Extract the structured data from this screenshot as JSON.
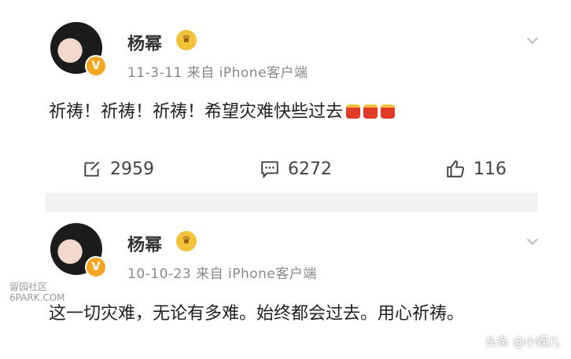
{
  "posts": [
    {
      "username": "杨幂",
      "meta": "11-3-11 来自 iPhone客户端",
      "content": "祈祷！祈祷！祈祷！希望灾难快些过去",
      "emoji_count": 3,
      "repost": "2959",
      "comment": "6272",
      "like": "116"
    },
    {
      "username": "杨幂",
      "meta": "10-10-23 来自 iPhone客户端",
      "content": "这一切灾难，无论有多难。始终都会过去。用心祈祷。"
    }
  ],
  "watermark_left": {
    "line1": "留园社区",
    "line2": "6PARK.COM"
  },
  "watermark_right": "头条 @小娱儿",
  "badge_icon": "verified-v-icon",
  "colors": {
    "badge": "#f5a623",
    "crown": "#f4c23a",
    "meta": "#888888",
    "separator": "#f2f2f2"
  }
}
